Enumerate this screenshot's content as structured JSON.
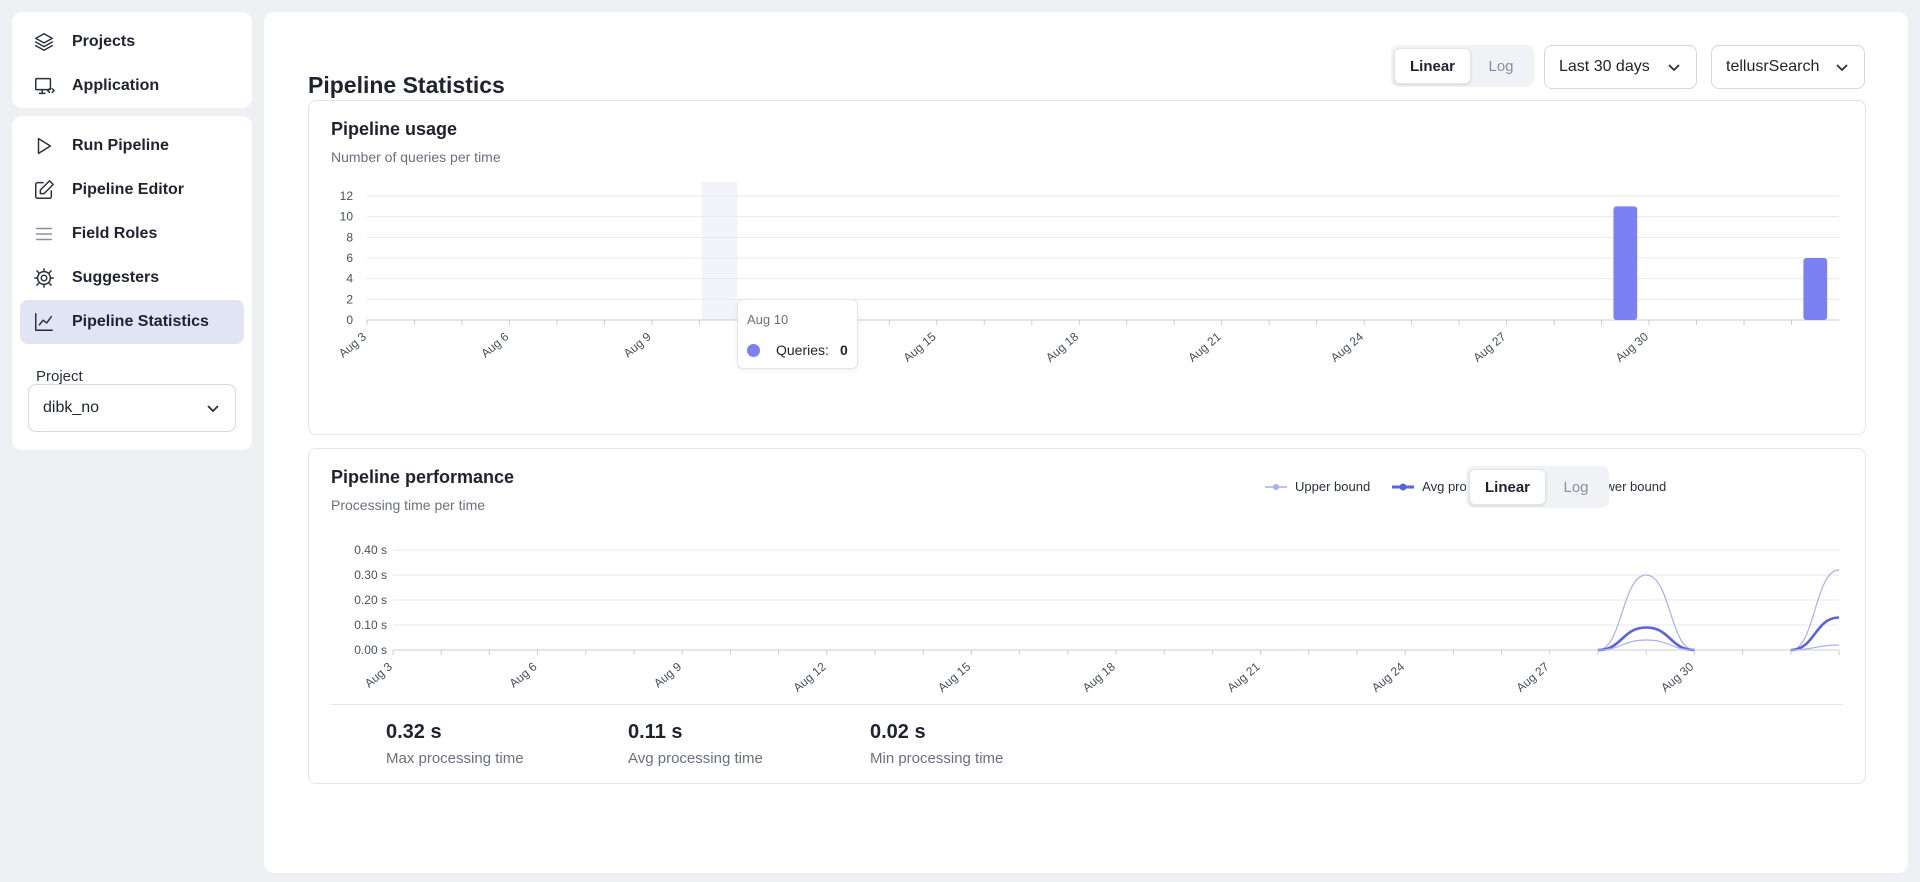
{
  "sidebar": {
    "top_items": [
      {
        "label": "Projects",
        "icon": "layers-icon"
      },
      {
        "label": "Application",
        "icon": "monitor-code-icon"
      }
    ],
    "main_items": [
      {
        "label": "Run Pipeline",
        "icon": "play-icon"
      },
      {
        "label": "Pipeline Editor",
        "icon": "edit-icon"
      },
      {
        "label": "Field Roles",
        "icon": "list-icon"
      },
      {
        "label": "Suggesters",
        "icon": "gear-icon"
      },
      {
        "label": "Pipeline Statistics",
        "icon": "chart-line-icon",
        "active": true
      }
    ],
    "project_label": "Project",
    "project_value": "dibk_no"
  },
  "header": {
    "title": "Pipeline Statistics",
    "scale_options": [
      "Linear",
      "Log"
    ],
    "scale_selected": "Linear",
    "range_value": "Last 30 days",
    "pipeline_value": "tellusrSearch"
  },
  "usage": {
    "title": "Pipeline usage",
    "subtitle": "Number of queries per time",
    "tooltip": {
      "date": "Aug 10",
      "label": "Queries:",
      "value": "0"
    }
  },
  "performance": {
    "title": "Pipeline performance",
    "subtitle": "Processing time per time",
    "legend": [
      "Upper bound",
      "Avg processing time",
      "Lower bound"
    ],
    "scale_options": [
      "Linear",
      "Log"
    ],
    "scale_selected": "Linear",
    "stats": [
      {
        "value": "0.32 s",
        "label": "Max processing time"
      },
      {
        "value": "0.11 s",
        "label": "Avg processing time"
      },
      {
        "value": "0.02 s",
        "label": "Min processing time"
      }
    ]
  },
  "colors": {
    "accent": "#7b81f3",
    "line": "#5a62e0",
    "bound": "#a9adf6",
    "active_nav": "#e1e4f3"
  },
  "chart_data": [
    {
      "type": "bar",
      "title": "Pipeline usage",
      "subtitle": "Number of queries per time",
      "x": [
        "Aug 3",
        "Aug 4",
        "Aug 5",
        "Aug 6",
        "Aug 7",
        "Aug 8",
        "Aug 9",
        "Aug 10",
        "Aug 11",
        "Aug 12",
        "Aug 13",
        "Aug 14",
        "Aug 15",
        "Aug 16",
        "Aug 17",
        "Aug 18",
        "Aug 19",
        "Aug 20",
        "Aug 21",
        "Aug 22",
        "Aug 23",
        "Aug 24",
        "Aug 25",
        "Aug 26",
        "Aug 27",
        "Aug 28",
        "Aug 29",
        "Aug 30",
        "Aug 31",
        "Sep 1",
        "Sep 2"
      ],
      "xticks": [
        "Aug 3",
        "Aug 6",
        "Aug 9",
        "Aug 12",
        "Aug 15",
        "Aug 18",
        "Aug 21",
        "Aug 24",
        "Aug 27",
        "Aug 30"
      ],
      "values": [
        0,
        0,
        0,
        0,
        0,
        0,
        0,
        0,
        0,
        0,
        0,
        0,
        0,
        0,
        0,
        0,
        0,
        0,
        0,
        0,
        0,
        0,
        0,
        0,
        0,
        0,
        11,
        0,
        0,
        0,
        6
      ],
      "yticks": [
        0,
        2,
        4,
        6,
        8,
        10,
        12
      ],
      "ylim": [
        0,
        12
      ],
      "grid": true,
      "highlight": "Aug 10"
    },
    {
      "type": "line",
      "title": "Pipeline performance",
      "subtitle": "Processing time per time",
      "x": [
        "Aug 3",
        "Aug 4",
        "Aug 5",
        "Aug 6",
        "Aug 7",
        "Aug 8",
        "Aug 9",
        "Aug 10",
        "Aug 11",
        "Aug 12",
        "Aug 13",
        "Aug 14",
        "Aug 15",
        "Aug 16",
        "Aug 17",
        "Aug 18",
        "Aug 19",
        "Aug 20",
        "Aug 21",
        "Aug 22",
        "Aug 23",
        "Aug 24",
        "Aug 25",
        "Aug 26",
        "Aug 27",
        "Aug 28",
        "Aug 29",
        "Aug 30",
        "Aug 31",
        "Sep 1",
        "Sep 2"
      ],
      "xticks": [
        "Aug 3",
        "Aug 6",
        "Aug 9",
        "Aug 12",
        "Aug 15",
        "Aug 18",
        "Aug 21",
        "Aug 24",
        "Aug 27",
        "Aug 30"
      ],
      "yticks": [
        "0.00 s",
        "0.10 s",
        "0.20 s",
        "0.30 s",
        "0.40 s"
      ],
      "ylim": [
        0,
        0.4
      ],
      "series": [
        {
          "name": "Upper bound",
          "values": [
            null,
            null,
            null,
            null,
            null,
            null,
            null,
            null,
            null,
            null,
            null,
            null,
            null,
            null,
            null,
            null,
            null,
            null,
            null,
            null,
            null,
            null,
            null,
            null,
            null,
            0,
            0.3,
            0,
            null,
            0,
            0.32
          ]
        },
        {
          "name": "Avg processing time",
          "values": [
            null,
            null,
            null,
            null,
            null,
            null,
            null,
            null,
            null,
            null,
            null,
            null,
            null,
            null,
            null,
            null,
            null,
            null,
            null,
            null,
            null,
            null,
            null,
            null,
            null,
            0,
            0.09,
            0,
            null,
            0,
            0.13
          ]
        },
        {
          "name": "Lower bound",
          "values": [
            null,
            null,
            null,
            null,
            null,
            null,
            null,
            null,
            null,
            null,
            null,
            null,
            null,
            null,
            null,
            null,
            null,
            null,
            null,
            null,
            null,
            null,
            null,
            null,
            null,
            0,
            0.04,
            0,
            null,
            0,
            0.02
          ]
        }
      ],
      "legend_position": "top-right",
      "grid": true
    }
  ]
}
